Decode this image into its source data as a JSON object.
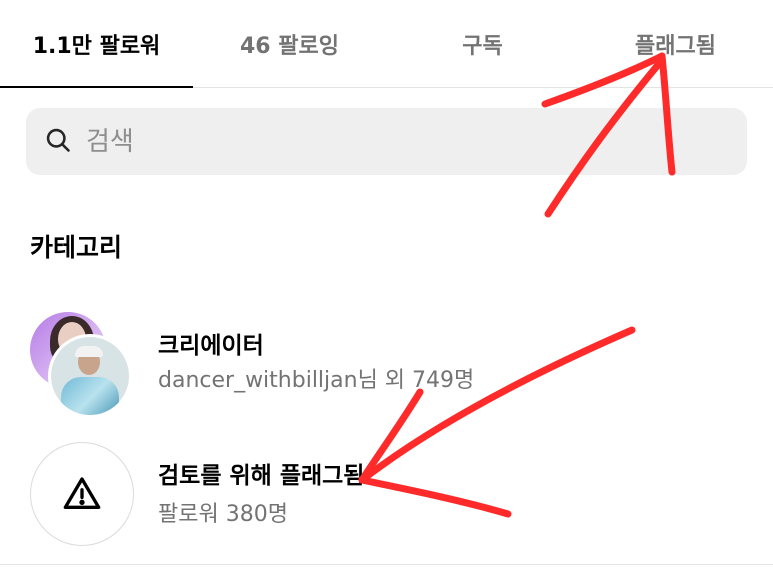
{
  "tabs": [
    {
      "label": "1.1만 팔로워",
      "active": true
    },
    {
      "label": "46 팔로잉",
      "active": false
    },
    {
      "label": "구독",
      "active": false
    },
    {
      "label": "플래그됨",
      "active": false
    }
  ],
  "search": {
    "placeholder": "검색",
    "icon": "search-icon"
  },
  "section_title": "카테고리",
  "categories": [
    {
      "title": "크리에이터",
      "subtitle": "dancer_withbilljan님 외 749명",
      "icon": "avatar-stack"
    },
    {
      "title": "검토를 위해 플래그됨",
      "subtitle": "팔로워 380명",
      "icon": "warning-icon"
    }
  ],
  "annotation_color": "#ff2a2a"
}
